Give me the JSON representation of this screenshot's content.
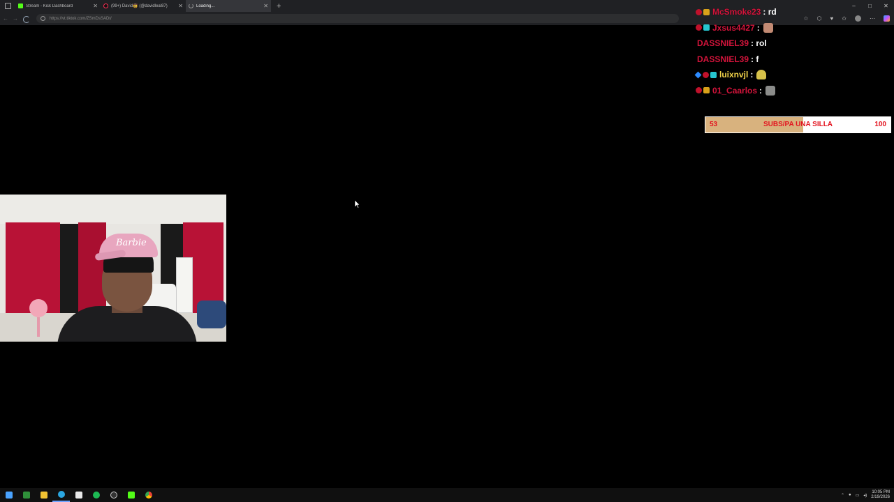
{
  "browser": {
    "tabs": [
      {
        "title": "Stream - Kick Dashboard",
        "favicon": "kick-icon",
        "active": false
      },
      {
        "title": "(99+) David🤠 (@davidleal87)",
        "favicon": "tiktok-icon",
        "active": false
      },
      {
        "title": "Loading...",
        "favicon": "loading-icon",
        "active": true
      }
    ],
    "url": "https://vt.tiktok.com/ZSmDsSADt/",
    "window_controls": [
      "–",
      "□",
      "✕"
    ]
  },
  "chat": {
    "messages": [
      {
        "user": "McSmoke23",
        "message": ": rd",
        "badges": [
          "dot",
          "crown"
        ],
        "color": "red",
        "emote": null
      },
      {
        "user": "Jxsus4427",
        "message": ":",
        "badges": [
          "dot",
          "gem"
        ],
        "color": "red",
        "emote": "e1"
      },
      {
        "user": "DASSNIEL39",
        "message": ": rol",
        "badges": [],
        "color": "red",
        "emote": null
      },
      {
        "user": "DASSNIEL39",
        "message": ": f",
        "badges": [],
        "color": "red",
        "emote": null
      },
      {
        "user": "luixnvjl",
        "message": ":",
        "badges": [
          "cube",
          "dot",
          "gem"
        ],
        "color": "yellow",
        "emote": "e2"
      },
      {
        "user": "01_Caarlos",
        "message": ":",
        "badges": [
          "dot",
          "crown"
        ],
        "color": "red",
        "emote": "e3"
      }
    ]
  },
  "goal": {
    "current": "53",
    "label": "SUBS/PA UNA SILLA",
    "target": "100",
    "progress": 0.53
  },
  "webcam": {
    "cap_text": "Barbie"
  },
  "taskbar": {
    "time": "10:05 PM",
    "date": "2/19/2026",
    "apps": [
      "start-icon",
      "terminal-icon",
      "file-explorer-icon",
      "edge-icon",
      "notepad-icon",
      "spotify-icon",
      "obs-icon",
      "kick-icon",
      "chrome-icon"
    ]
  },
  "colors": {
    "kick_green": "#53fc18",
    "chat_red": "#d3143b",
    "chat_yellow": "#f4d54a",
    "goal_fill": "#d8b27e",
    "goal_text": "#e3131f"
  }
}
